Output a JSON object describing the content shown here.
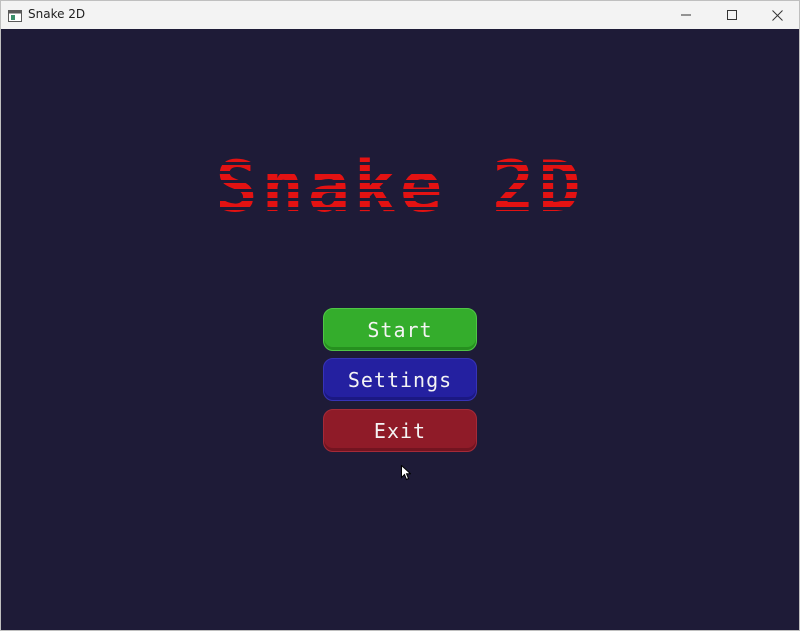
{
  "window": {
    "title": "Snake 2D"
  },
  "game": {
    "title": "Snake 2D"
  },
  "menu": {
    "start_label": "Start",
    "settings_label": "Settings",
    "exit_label": "Exit"
  },
  "icons": {
    "app": "app-window-icon",
    "minimize": "minimize-icon",
    "maximize": "maximize-icon",
    "close": "close-icon",
    "cursor": "mouse-cursor-icon"
  },
  "colors": {
    "background": "#1e1b37",
    "title": "#e31212",
    "start": "#34ad2c",
    "settings": "#2420a0",
    "exit": "#8f1b28"
  }
}
